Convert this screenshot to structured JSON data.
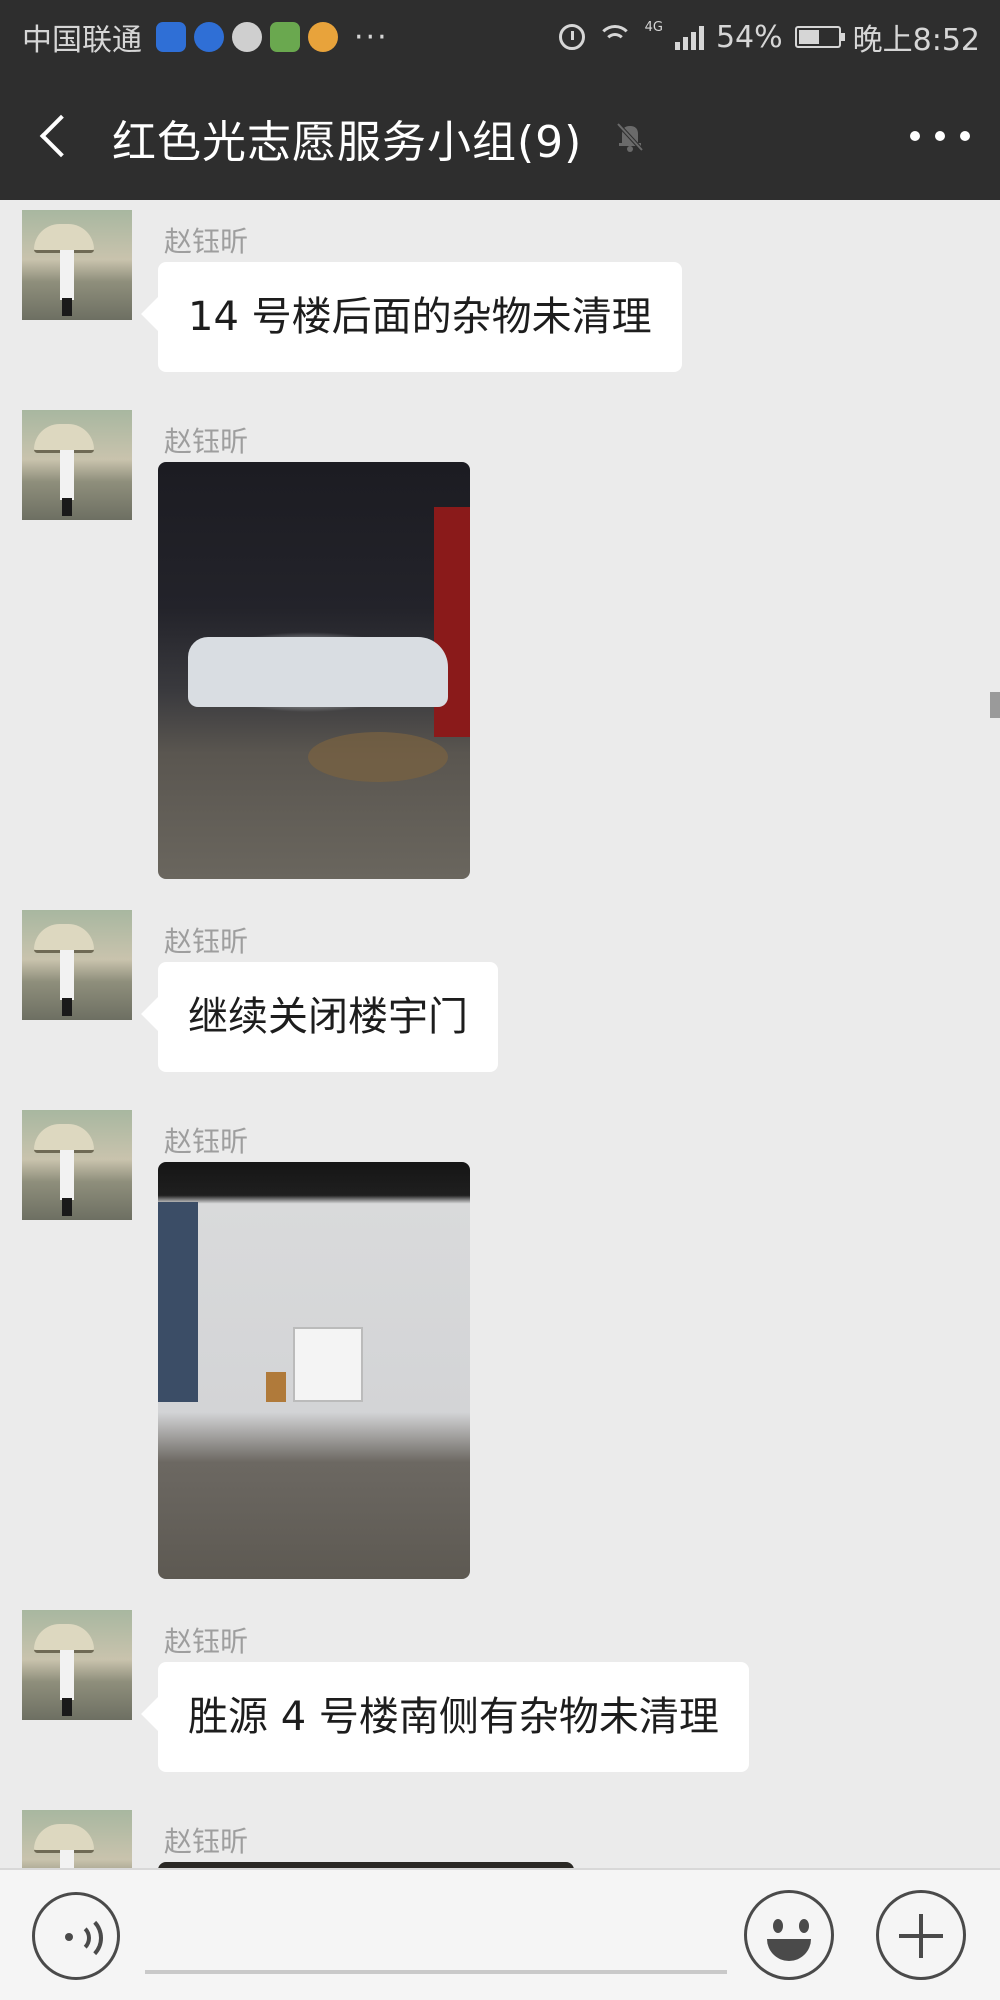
{
  "status_bar": {
    "carrier": "中国联通",
    "app_icon_colors": [
      "#2f6fd6",
      "#2f6fd6",
      "#cfcfcf",
      "#6aa84f",
      "#e8a33b"
    ],
    "overflow": "···",
    "network": "4G",
    "battery_text": "54%",
    "battery_level": 0.54,
    "time": "晚上8:52"
  },
  "header": {
    "back_icon": "chevron-left-icon",
    "title": "红色光志愿服务小组(9)",
    "mute_icon": "bell-off-icon",
    "more_icon": "more-dots-icon"
  },
  "messages": [
    {
      "sender": "赵钰昕",
      "type": "text",
      "text": "14 号楼后面的杂物未清理"
    },
    {
      "sender": "赵钰昕",
      "type": "image",
      "image": "night-photo-debris-pile"
    },
    {
      "sender": "赵钰昕",
      "type": "text",
      "text": "继续关闭楼宇门"
    },
    {
      "sender": "赵钰昕",
      "type": "text_image",
      "image": "night-photo-white-wall"
    },
    {
      "sender": "赵钰昕",
      "type": "text",
      "text": "胜源 4 号楼南侧有杂物未清理"
    },
    {
      "sender": "赵钰昕",
      "type": "image",
      "image": "partial-photo"
    }
  ],
  "input_bar": {
    "voice_icon": "voice-icon",
    "text_value": "",
    "emoji_icon": "emoji-icon",
    "plus_icon": "plus-icon"
  },
  "colors": {
    "header_bg": "#2e2e2e",
    "chat_bg": "#ebebeb",
    "bubble_bg": "#ffffff",
    "sender_text": "#9e9e9e"
  }
}
